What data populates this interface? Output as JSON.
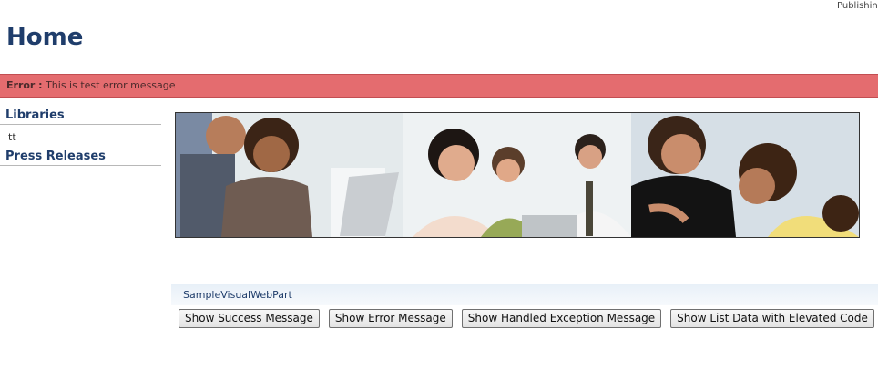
{
  "header": {
    "top_right_link": "Publishin",
    "title": "Home"
  },
  "error": {
    "label": "Error :",
    "message": "This is test error message"
  },
  "sidebar": {
    "sections": [
      {
        "heading": "Libraries",
        "items": [
          "tt"
        ]
      },
      {
        "heading": "Press Releases",
        "items": []
      }
    ]
  },
  "webpart": {
    "title": "SampleVisualWebPart",
    "buttons": [
      "Show Success Message",
      "Show Error Message",
      "Show Handled Exception Message",
      "Show List Data with Elevated Code"
    ]
  }
}
